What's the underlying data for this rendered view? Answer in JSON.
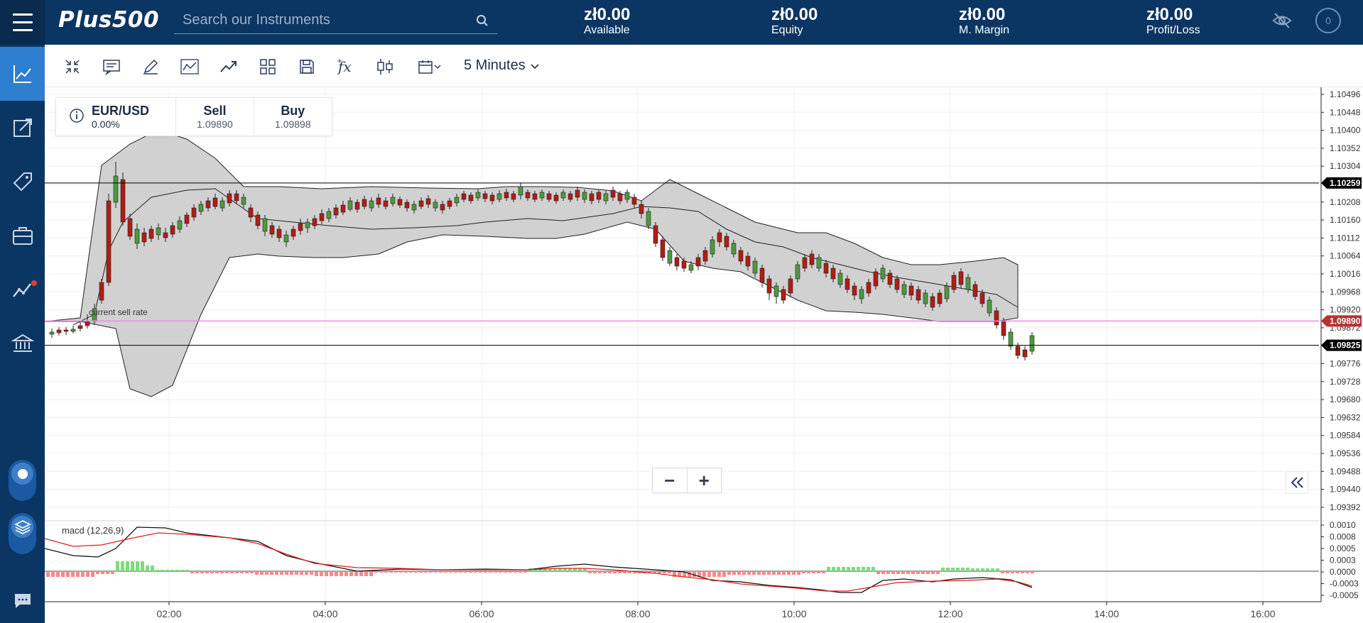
{
  "header": {
    "logo_text": "Plus500",
    "search_placeholder": "Search our Instruments",
    "stats": [
      {
        "value": "zł0.00",
        "label": "Available"
      },
      {
        "value": "zł0.00",
        "label": "Equity"
      },
      {
        "value": "zł0.00",
        "label": "M. Margin"
      },
      {
        "value": "zł0.00",
        "label": "Profit/Loss"
      }
    ],
    "notification_count": "0"
  },
  "sidebar": {
    "items": [
      {
        "icon": "chart-line-icon",
        "active": true
      },
      {
        "icon": "trade-icon",
        "active": false
      },
      {
        "icon": "tag-icon",
        "active": false
      },
      {
        "icon": "briefcase-icon",
        "active": false
      },
      {
        "icon": "insights-icon",
        "active": false
      },
      {
        "icon": "bank-icon",
        "active": false
      }
    ]
  },
  "toolbar": {
    "interval_label": "5 Minutes",
    "tools": [
      "collapse-icon",
      "comment-icon",
      "pencil-icon",
      "line-chart-icon",
      "trend-icon",
      "layout-icon",
      "save-icon",
      "function-icon",
      "candles-icon",
      "calendar-icon"
    ]
  },
  "instrument": {
    "symbol": "EUR/USD",
    "change": "0.00%",
    "sell_label": "Sell",
    "sell_price": "1.09890",
    "buy_label": "Buy",
    "buy_price": "1.09898"
  },
  "chart": {
    "current_sell_rate_label": "current sell rate",
    "indicator_label": "macd (12,26,9)",
    "price_ticks": [
      "1.10496",
      "1.10448",
      "1.10400",
      "1.10352",
      "1.10304",
      "1.10259",
      "1.10208",
      "1.10160",
      "1.10112",
      "1.10064",
      "1.10016",
      "1.09968",
      "1.09920",
      "1.09890",
      "1.09872",
      "1.09825",
      "1.09776",
      "1.09728",
      "1.09680",
      "1.09632",
      "1.09584",
      "1.09536",
      "1.09488",
      "1.09440",
      "1.09392"
    ],
    "highlighted_levels": [
      {
        "label": "1.10259",
        "color": "#000000"
      },
      {
        "label": "1.09890",
        "color": "#b83232"
      },
      {
        "label": "1.09825",
        "color": "#000000"
      }
    ],
    "macd_ticks": [
      "0.0010",
      "0.0008",
      "0.0005",
      "0.0003",
      "0.0000",
      "-0.0003",
      "-0.0005"
    ],
    "time_ticks": [
      "02:00",
      "04:00",
      "06:00",
      "08:00",
      "10:00",
      "12:00",
      "14:00",
      "16:00"
    ],
    "colors": {
      "up": "#4c9a3e",
      "down": "#b01d16",
      "band": "#cfcfcf",
      "sell_line": "#f08ddb",
      "macd_line": "#111111",
      "signal_line": "#e0201e",
      "hist_up": "#7ddc7c",
      "hist_down": "#f58a8a"
    }
  }
}
